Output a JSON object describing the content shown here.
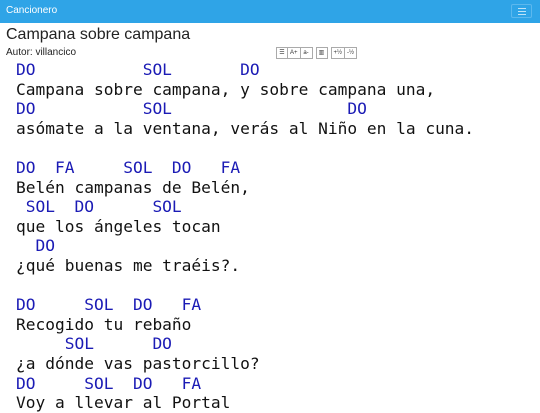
{
  "app": {
    "brand": "Cancionero",
    "menu_icon": "hamburger-icon"
  },
  "song": {
    "title": "Campana sobre campana",
    "author": "Autor: villancico",
    "lines": [
      {
        "type": "chord",
        "text": "DO           SOL       DO"
      },
      {
        "type": "lyric",
        "text": "Campana sobre campana, y sobre campana una,"
      },
      {
        "type": "chord",
        "text": "DO           SOL                  DO"
      },
      {
        "type": "lyric",
        "text": "asómate a la ventana, verás al Niño en la cuna."
      },
      {
        "type": "blank",
        "text": ""
      },
      {
        "type": "chord",
        "text": "DO  FA     SOL  DO   FA"
      },
      {
        "type": "lyric",
        "text": "Belén campanas de Belén,"
      },
      {
        "type": "chord",
        "text": " SOL  DO      SOL"
      },
      {
        "type": "lyric",
        "text": "que los ángeles tocan"
      },
      {
        "type": "chord",
        "text": "  DO"
      },
      {
        "type": "lyric",
        "text": "¿qué buenas me traéis?."
      },
      {
        "type": "blank",
        "text": ""
      },
      {
        "type": "chord",
        "text": "DO     SOL  DO   FA"
      },
      {
        "type": "lyric",
        "text": "Recogido tu rebaño"
      },
      {
        "type": "chord",
        "text": "     SOL      DO"
      },
      {
        "type": "lyric",
        "text": "¿a dónde vas pastorcillo?"
      },
      {
        "type": "chord",
        "text": "DO     SOL  DO   FA"
      },
      {
        "type": "lyric",
        "text": "Voy a llevar al Portal"
      }
    ]
  },
  "toolbar": {
    "list": "☰",
    "font_up": "A+",
    "font_down": "a-",
    "columns": "▥",
    "transpose_up": "+½",
    "transpose_down": "-½"
  }
}
